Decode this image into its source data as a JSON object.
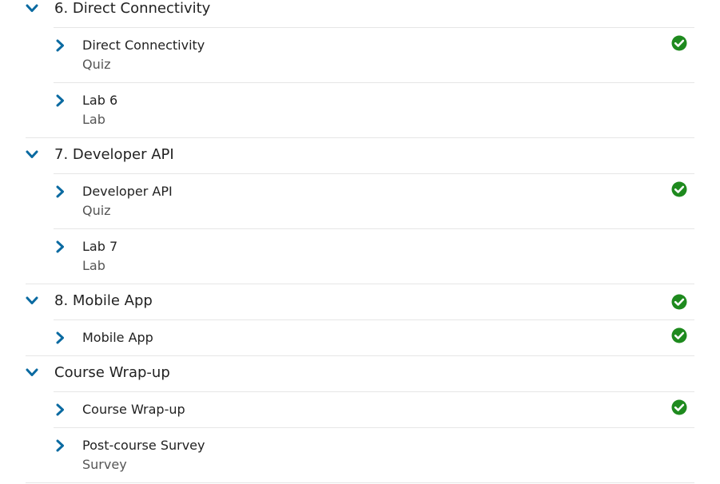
{
  "colors": {
    "accent": "#0a6aa1",
    "check": "#1e8a1e",
    "divider": "#e6e6e6"
  },
  "sections": [
    {
      "title": "6. Direct Connectivity",
      "completed": false,
      "items": [
        {
          "title": "Direct Connectivity",
          "type": "Quiz",
          "completed": true
        },
        {
          "title": "Lab 6",
          "type": "Lab",
          "completed": false
        }
      ]
    },
    {
      "title": "7. Developer API",
      "completed": false,
      "items": [
        {
          "title": "Developer API",
          "type": "Quiz",
          "completed": true
        },
        {
          "title": "Lab 7",
          "type": "Lab",
          "completed": false
        }
      ]
    },
    {
      "title": "8. Mobile App",
      "completed": true,
      "items": [
        {
          "title": "Mobile App",
          "type": "",
          "completed": true
        }
      ]
    },
    {
      "title": "Course Wrap-up",
      "completed": false,
      "items": [
        {
          "title": "Course Wrap-up",
          "type": "",
          "completed": true
        },
        {
          "title": "Post-course Survey",
          "type": "Survey",
          "completed": false
        }
      ]
    }
  ]
}
